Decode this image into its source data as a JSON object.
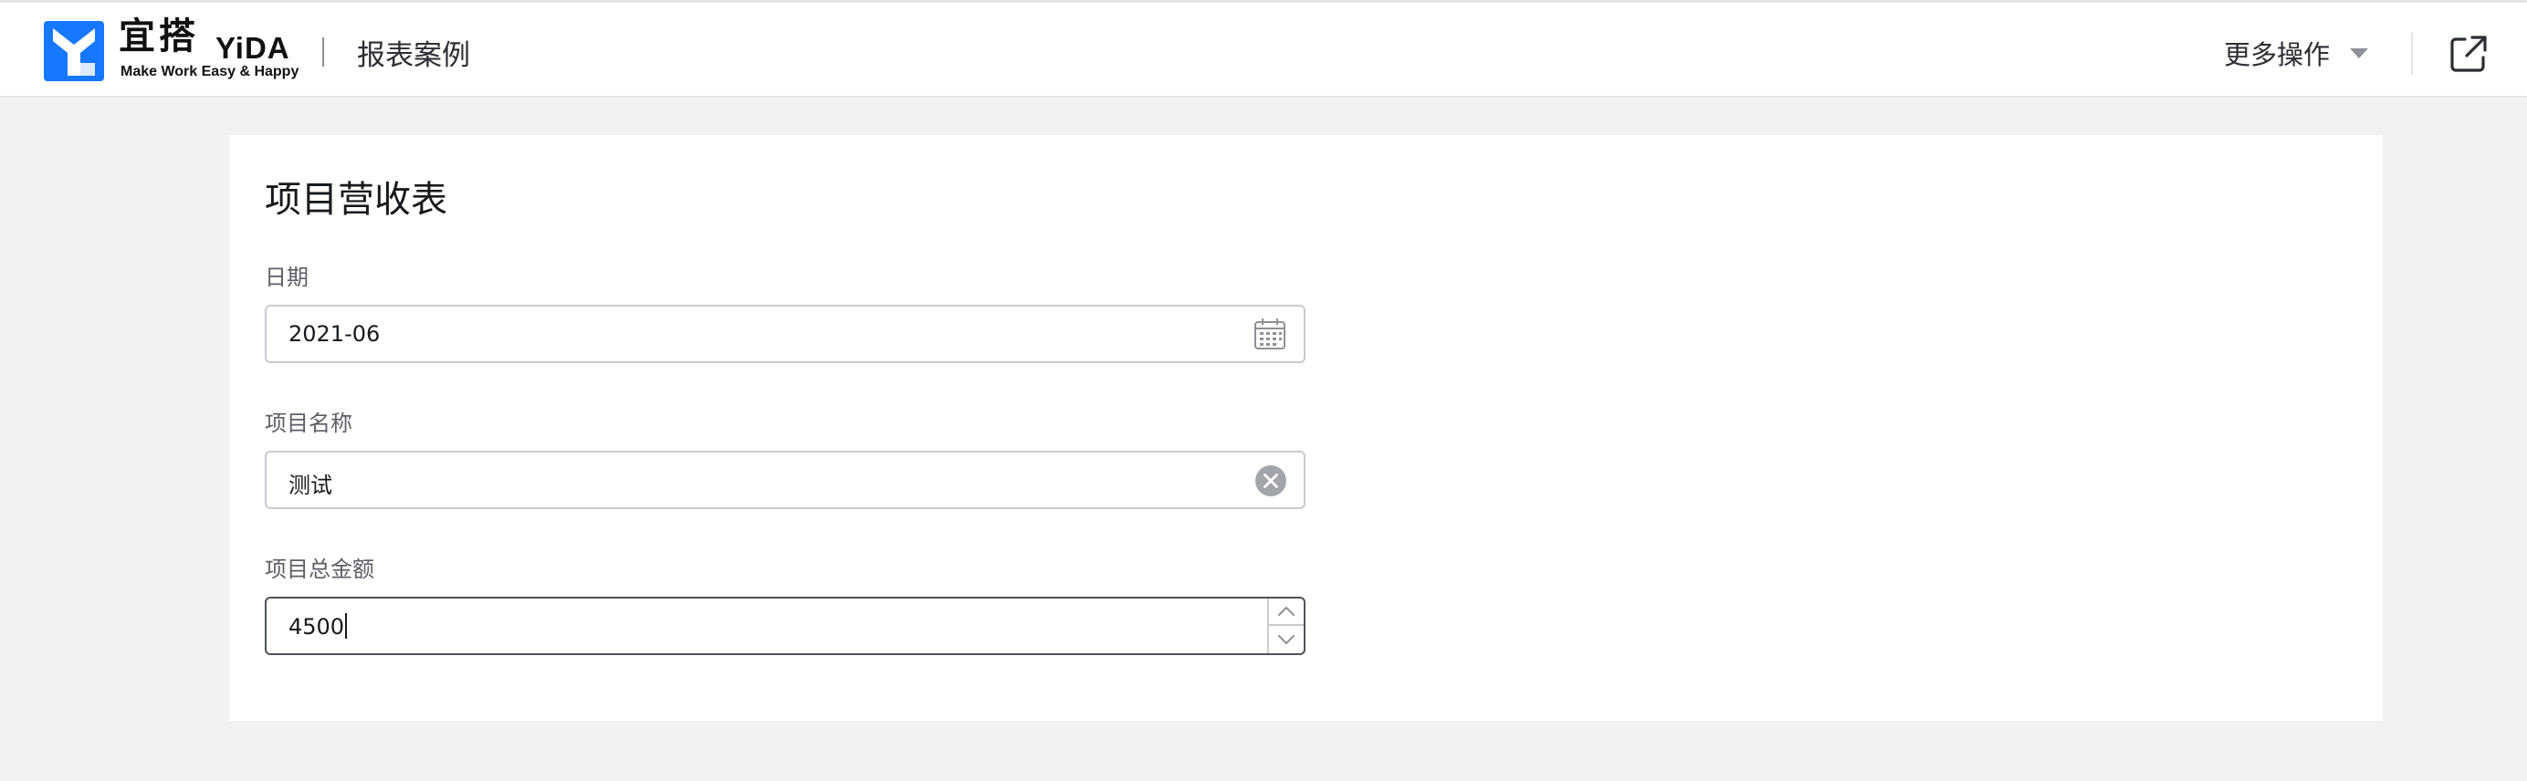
{
  "header": {
    "brand_name": "宜搭",
    "brand_en": "YiDA",
    "brand_slogan": "Make Work Easy & Happy",
    "page_title": "报表案例",
    "more_actions_label": "更多操作",
    "icons": {
      "logo": "yida-logo-icon",
      "more_actions": "caret-down-icon",
      "open_external": "open-external-icon"
    },
    "brand_color": "#1677ff"
  },
  "form": {
    "title": "项目营收表",
    "fields": [
      {
        "label": "日期",
        "value": "2021-06",
        "icon": "calendar-icon"
      },
      {
        "label": "项目名称",
        "value": "测试",
        "icon": "clear-icon"
      },
      {
        "label": "项目总金额",
        "value": "4500",
        "icon": "stepper-icon"
      }
    ]
  }
}
